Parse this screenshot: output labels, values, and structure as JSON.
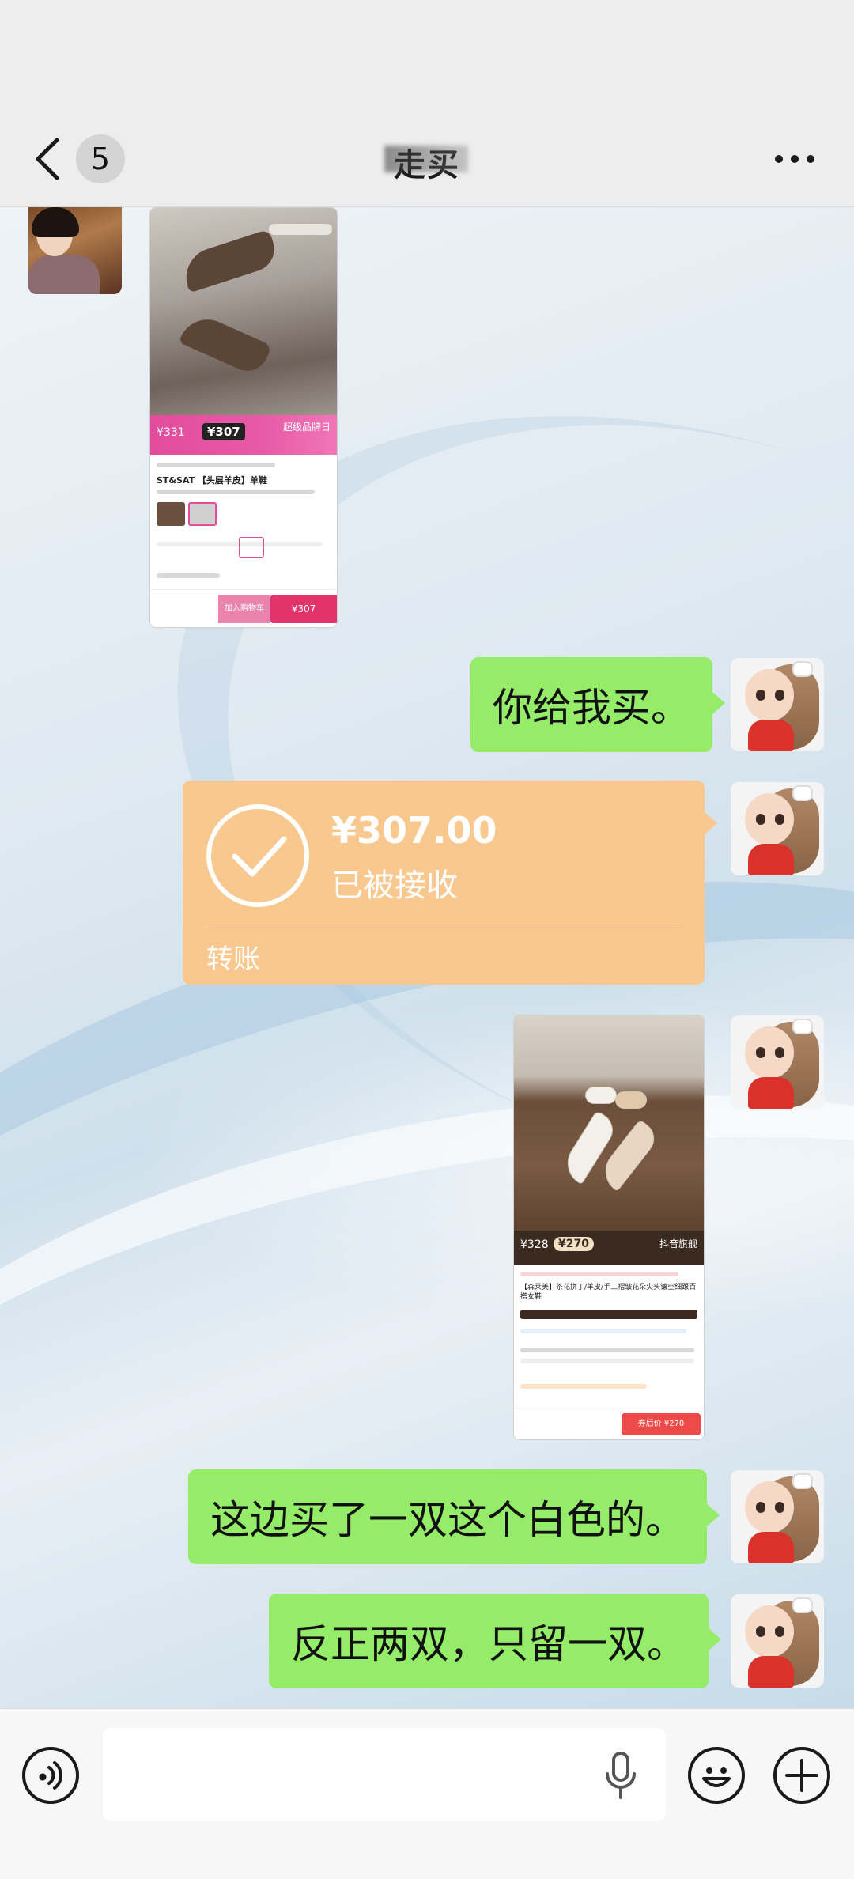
{
  "header": {
    "back_badge": "5",
    "title": "走买"
  },
  "messages": {
    "m1": {
      "type": "image",
      "side": "left",
      "content": "product-screenshot"
    },
    "m2": {
      "type": "text",
      "side": "right",
      "text": "你给我买。"
    },
    "m3": {
      "type": "transfer",
      "side": "right",
      "amount": "¥307.00",
      "status": "已被接收",
      "label": "转账"
    },
    "m4": {
      "type": "image",
      "side": "right",
      "content": "product-screenshot"
    },
    "m5": {
      "type": "text",
      "side": "right",
      "text": "这边买了一双这个白色的。"
    },
    "m6": {
      "type": "text",
      "side": "right",
      "text": "反正两双，只留一双。"
    }
  },
  "shot1": {
    "price_old": "¥331",
    "price_new": "¥307",
    "store_tag": "超级品牌日",
    "title": "ST&SAT 【头层羊皮】单鞋",
    "buy": "¥307",
    "cart": "加入购物车"
  },
  "shot2": {
    "price_old": "¥328",
    "price_new": "¥270",
    "store": "抖音旗舰",
    "title": "【森莱美】茶花拼丁/羊皮/手工褶皱花朵尖头镶空细跟百搭女鞋",
    "buy": "券后价 ¥270"
  },
  "input": {
    "placeholder": ""
  },
  "colors": {
    "bubble_green": "#95ec69",
    "transfer_orange": "#f8c88e",
    "header_bg": "#ededed"
  }
}
